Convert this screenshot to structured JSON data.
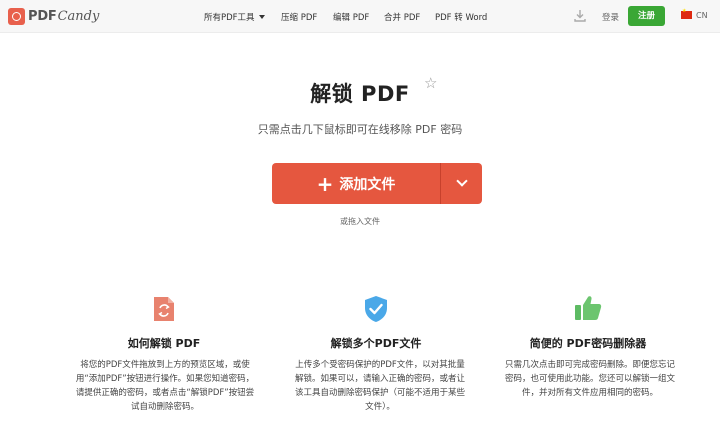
{
  "header": {
    "logo_pdf": "PDF",
    "logo_candy": "Candy",
    "nav": [
      {
        "label": "所有PDF工具"
      },
      {
        "label": "压缩 PDF"
      },
      {
        "label": "编辑 PDF"
      },
      {
        "label": "合并 PDF"
      },
      {
        "label": "PDF 转 Word"
      }
    ],
    "download_icon": "download-icon",
    "login": "登录",
    "register": "注册",
    "language": "CN",
    "brand_color": "#e8604c",
    "register_color": "#3aa735"
  },
  "hero": {
    "title": "解锁 PDF",
    "favorite_icon": "star-icon",
    "subtitle": "只需点击几下鼠标即可在线移除 PDF 密码",
    "add_button": "添加文件",
    "add_icon": "plus-icon",
    "dropdown_icon": "chevron-down-icon",
    "drag_hint": "或拖入文件",
    "button_color": "#e5573f"
  },
  "features": [
    {
      "icon": "unlock-file-icon",
      "title": "如何解锁 PDF",
      "lines": [
        "将您的PDF文件拖放到上方的预览区域，或使",
        "用“添加PDF”按钮进行操作。如果您知道密码，",
        "请提供正确的密码，或者点击“解锁PDF”按钮尝",
        "试自动删除密码。"
      ]
    },
    {
      "icon": "shield-check-icon",
      "title": "解锁多个PDF文件",
      "lines": [
        "上传多个受密码保护的PDF文件，以对其批量",
        "解锁。如果可以，请输入正确的密码，或者让",
        "该工具自动删除密码保护（可能不适用于某些",
        "文件）。"
      ]
    },
    {
      "icon": "thumbs-up-icon",
      "title": "简便的 PDF密码删除器",
      "lines": [
        "只需几次点击即可完成密码删除。即便您忘记",
        "密码，也可使用此功能。您还可以解锁一组文",
        "件，并对所有文件应用相同的密码。"
      ]
    }
  ]
}
